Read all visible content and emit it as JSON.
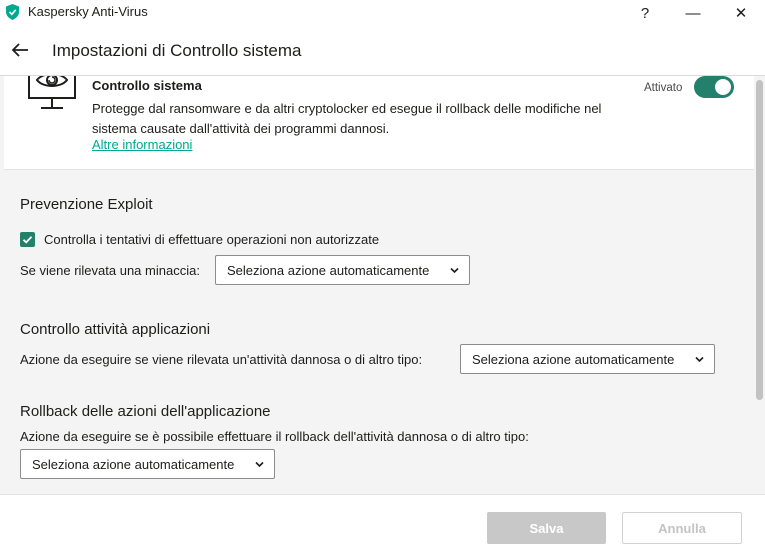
{
  "window": {
    "title": "Kaspersky Anti-Virus",
    "help": "?",
    "minimize": "—",
    "close": "✕"
  },
  "header": {
    "title": "Impostazioni di Controllo sistema"
  },
  "card": {
    "title": "Controllo sistema",
    "description": "Protegge dal ransomware e da altri cryptolocker ed esegue il rollback delle modifiche nel sistema causate dall'attività dei programmi dannosi.",
    "link": "Altre informazioni",
    "toggle_label": "Attivato",
    "toggle_on": true
  },
  "exploit": {
    "title": "Prevenzione Exploit",
    "checkbox_label": "Controlla i tentativi di effettuare operazioni non autorizzate",
    "checked": true,
    "threat_label": "Se viene rilevata una minaccia:",
    "threat_select": "Seleziona azione automaticamente"
  },
  "app_control": {
    "title": "Controllo attività applicazioni",
    "action_label": "Azione da eseguire se viene rilevata un'attività dannosa o di altro tipo:",
    "action_select": "Seleziona azione automaticamente"
  },
  "rollback": {
    "title": "Rollback delle azioni dell'applicazione",
    "action_label": "Azione da eseguire se è possibile effettuare il rollback dell'attività dannosa o di altro tipo:",
    "action_select": "Seleziona azione automaticamente"
  },
  "footer": {
    "save": "Salva",
    "cancel": "Annulla"
  },
  "colors": {
    "accent": "#23806b",
    "link": "#00a88e"
  }
}
